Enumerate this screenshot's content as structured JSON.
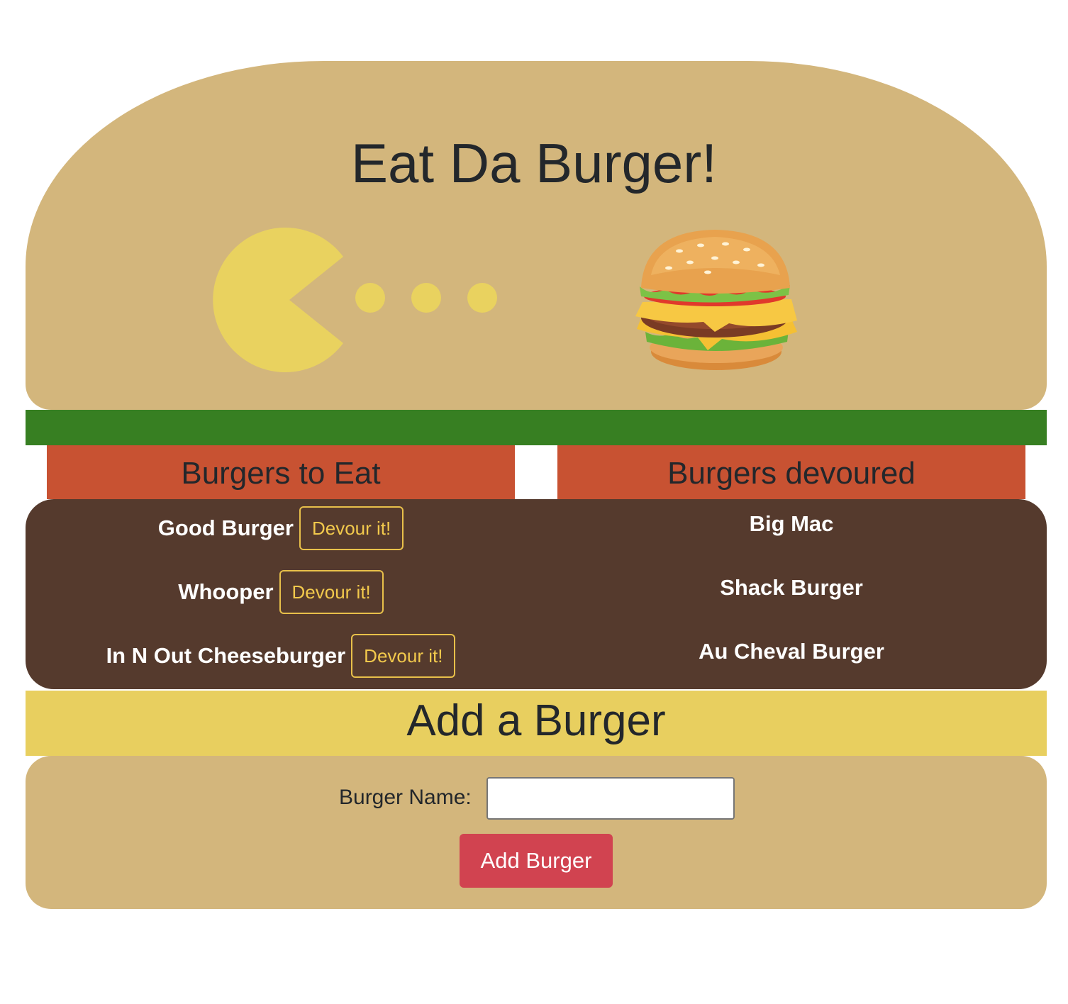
{
  "header": {
    "title": "Eat Da Burger!"
  },
  "illustration": {
    "pacman_color": "#e9d25f",
    "pacman_icon": "pacman-icon",
    "dots_icon": "pellet-dots-icon",
    "burger_icon": "hamburger-icon"
  },
  "colors": {
    "bun": "#d3b67c",
    "lettuce": "#377f22",
    "tomato": "#c85232",
    "patty": "#553a2d",
    "cheese": "#e8cf5f",
    "devour_button": "#f2c94c",
    "add_button": "#d14350"
  },
  "to_eat": {
    "heading": "Burgers to Eat",
    "button_label": "Devour it!",
    "items": [
      {
        "name": "Good Burger"
      },
      {
        "name": "Whooper"
      },
      {
        "name": "In N Out Cheeseburger"
      }
    ]
  },
  "devoured": {
    "heading": "Burgers devoured",
    "items": [
      {
        "name": "Big Mac"
      },
      {
        "name": "Shack Burger"
      },
      {
        "name": "Au Cheval Burger"
      }
    ]
  },
  "add_form": {
    "heading": "Add a Burger",
    "label": "Burger Name:",
    "value": "",
    "submit_label": "Add Burger"
  }
}
